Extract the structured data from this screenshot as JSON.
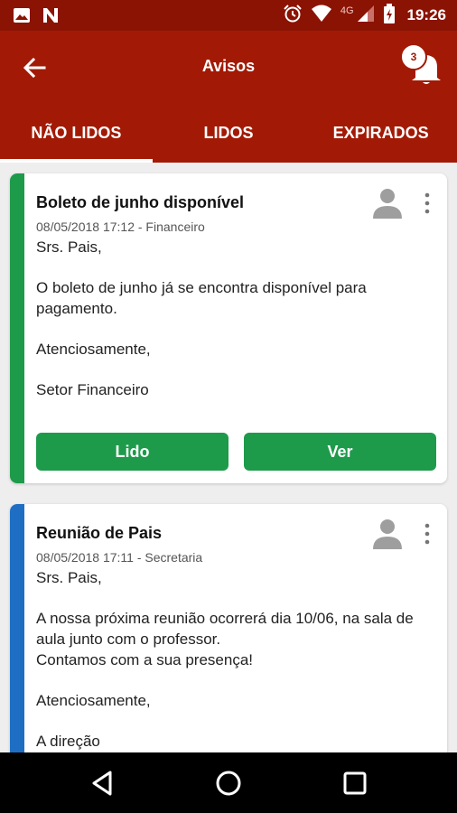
{
  "status_bar": {
    "network_label": "4G",
    "time": "19:26",
    "icons": [
      "image-icon",
      "n-icon",
      "alarm-icon",
      "wifi-icon",
      "signal-icon",
      "battery-icon"
    ]
  },
  "app_bar": {
    "title": "Avisos",
    "notification_count": "3"
  },
  "tabs": [
    {
      "label": "NÃO LIDOS",
      "active": true
    },
    {
      "label": "LIDOS",
      "active": false
    },
    {
      "label": "EXPIRADOS",
      "active": false
    }
  ],
  "cards": [
    {
      "title": "Boleto de junho disponível",
      "meta": "08/05/2018 17:12 - Financeiro",
      "accent_color": "#1e9a4b",
      "body": [
        "Srs. Pais,",
        "O boleto de junho já se encontra disponível para pagamento.",
        "Atenciosamente,",
        "Setor Financeiro"
      ],
      "actions": {
        "read_label": "Lido",
        "view_label": "Ver"
      }
    },
    {
      "title": "Reunião de Pais",
      "meta": "08/05/2018 17:11 - Secretaria",
      "accent_color": "#1e6fc4",
      "body_greeting": "Srs. Pais,",
      "body_lines": [
        "A nossa próxima reunião ocorrerá dia 10/06, na sala de aula junto com o professor.",
        "Contamos com a sua presença!"
      ],
      "body_closing": "Atenciosamente,",
      "body_signature": "A direção"
    }
  ],
  "colors": {
    "status_bar": "#8b1304",
    "app_bar": "#a21a05",
    "button": "#1e9a4b"
  }
}
